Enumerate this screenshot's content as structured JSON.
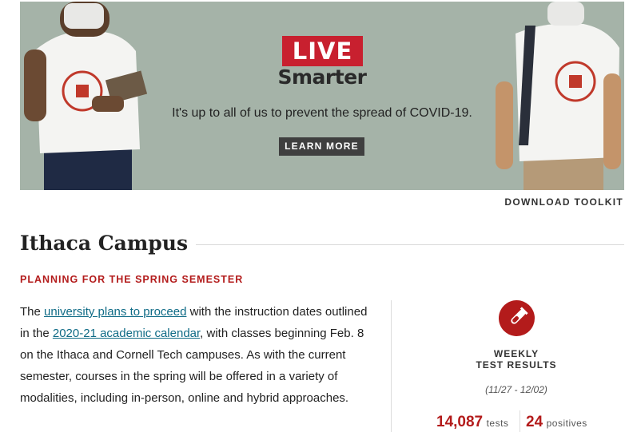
{
  "banner": {
    "badge": "LIVE",
    "headline": "Smarter",
    "tagline": "It's up to all of us to prevent the spread of COVID-19.",
    "cta_label": "LEARN MORE",
    "background_color": "#a5b3a8",
    "badge_color": "#c8202f"
  },
  "toolkit_link": "DOWNLOAD TOOLKIT",
  "section": {
    "title": "Ithaca Campus",
    "kicker": "PLANNING FOR THE SPRING SEMESTER",
    "para": {
      "t1": "The ",
      "link1": "university plans to proceed",
      "t2": " with the instruction dates outlined in the ",
      "link2": "2020-21 academic calendar",
      "t3": ", with classes beginning Feb. 8 on the Ithaca and Cornell Tech campuses. As with the current semester, courses in the spring will be offered in a variety of modalities, including in-person, online and hybrid approaches."
    }
  },
  "stats": {
    "icon": "test-tube-icon",
    "title_line1": "WEEKLY",
    "title_line2": "TEST RESULTS",
    "dates": "(11/27 - 12/02)",
    "tests_value": "14,087",
    "tests_label": "tests",
    "positives_value": "24",
    "positives_label": "positives",
    "accent_color": "#b31b1b"
  }
}
